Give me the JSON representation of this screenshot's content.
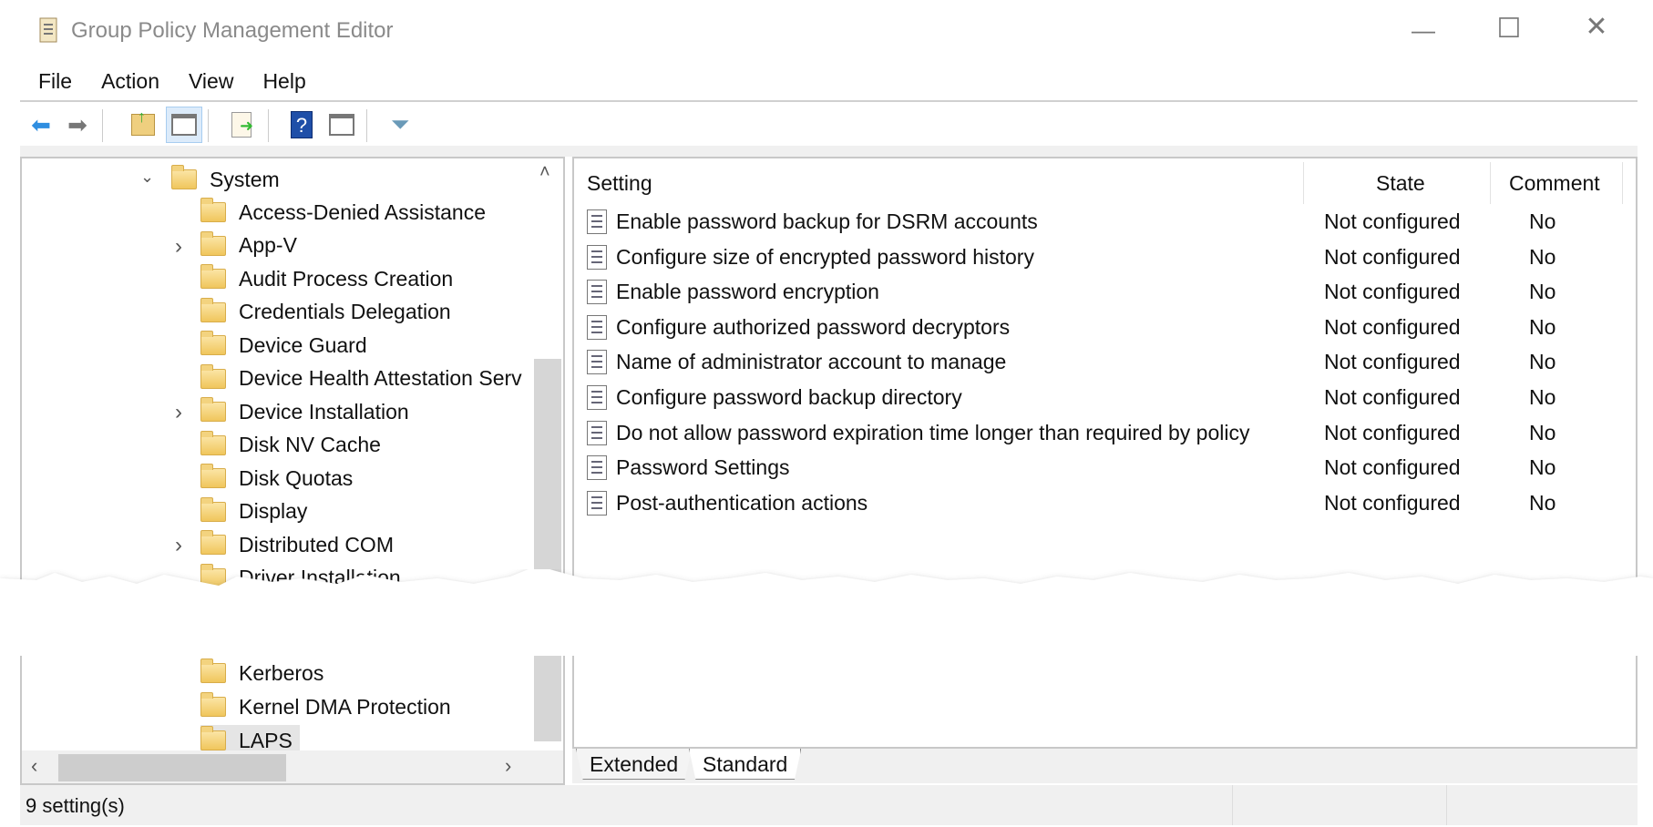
{
  "window": {
    "title": "Group Policy Management Editor",
    "controls": [
      "minimize",
      "maximize",
      "close"
    ]
  },
  "menu": [
    "File",
    "Action",
    "View",
    "Help"
  ],
  "toolbar": [
    "back-icon",
    "forward-icon",
    "up-folder-icon",
    "show-hide-tree-icon",
    "export-list-icon",
    "help-icon",
    "show-action-pane-icon",
    "filter-icon"
  ],
  "tree": {
    "parent": "System",
    "items": [
      {
        "label": "Access-Denied Assistance",
        "expandable": false
      },
      {
        "label": "App-V",
        "expandable": true
      },
      {
        "label": "Audit Process Creation",
        "expandable": false
      },
      {
        "label": "Credentials Delegation",
        "expandable": false
      },
      {
        "label": "Device Guard",
        "expandable": false
      },
      {
        "label": "Device Health Attestation Serv",
        "expandable": false
      },
      {
        "label": "Device Installation",
        "expandable": true
      },
      {
        "label": "Disk NV Cache",
        "expandable": false
      },
      {
        "label": "Disk Quotas",
        "expandable": false
      },
      {
        "label": "Display",
        "expandable": false
      },
      {
        "label": "Distributed COM",
        "expandable": true
      },
      {
        "label": "Driver Installation",
        "expandable": false
      }
    ],
    "items_after_break": [
      {
        "label": "Kerberos"
      },
      {
        "label": "Kernel DMA Protection"
      },
      {
        "label": "LAPS",
        "selected": true
      }
    ]
  },
  "list": {
    "columns": [
      "Setting",
      "State",
      "Comment"
    ],
    "rows": [
      {
        "setting": "Enable password backup for DSRM accounts",
        "state": "Not configured",
        "comment": "No"
      },
      {
        "setting": "Configure size of encrypted password history",
        "state": "Not configured",
        "comment": "No"
      },
      {
        "setting": "Enable password encryption",
        "state": "Not configured",
        "comment": "No"
      },
      {
        "setting": "Configure authorized password decryptors",
        "state": "Not configured",
        "comment": "No"
      },
      {
        "setting": "Name of administrator account to manage",
        "state": "Not configured",
        "comment": "No"
      },
      {
        "setting": "Configure password backup directory",
        "state": "Not configured",
        "comment": "No"
      },
      {
        "setting": "Do not allow password expiration time longer than required by policy",
        "state": "Not configured",
        "comment": "No"
      },
      {
        "setting": "Password Settings",
        "state": "Not configured",
        "comment": "No"
      },
      {
        "setting": "Post-authentication actions",
        "state": "Not configured",
        "comment": "No"
      }
    ]
  },
  "tabs": [
    "Extended",
    "Standard"
  ],
  "active_tab": "Standard",
  "status": "9 setting(s)"
}
